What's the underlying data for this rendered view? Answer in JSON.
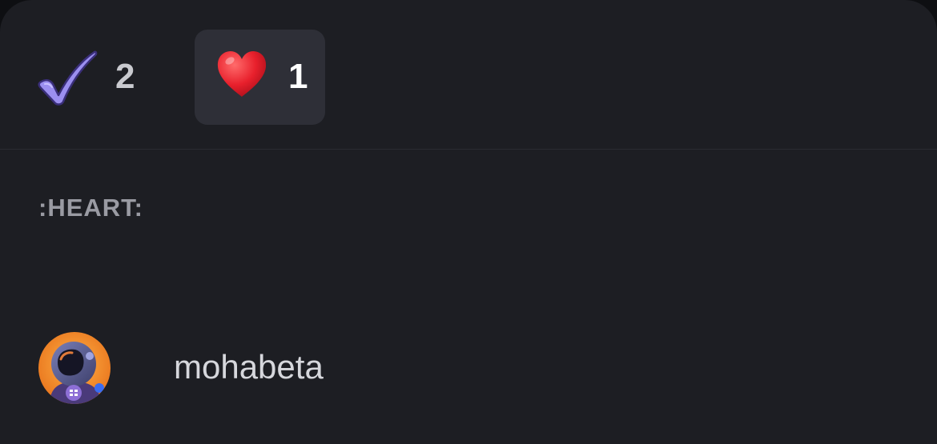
{
  "reactions": [
    {
      "emoji_icon": "heavy-check-mark-icon",
      "count": "2",
      "selected": false
    },
    {
      "emoji_icon": "red-heart-icon",
      "count": "1",
      "selected": true
    }
  ],
  "section": {
    "heading": ":HEART:"
  },
  "users": [
    {
      "username": "mohabeta",
      "avatar_icon": "astronaut-avatar"
    }
  ],
  "colors": {
    "background": "#1d1e23",
    "selected_tab": "#2e2f37",
    "heart": "#e8202c",
    "check": "#9b8ff0"
  }
}
